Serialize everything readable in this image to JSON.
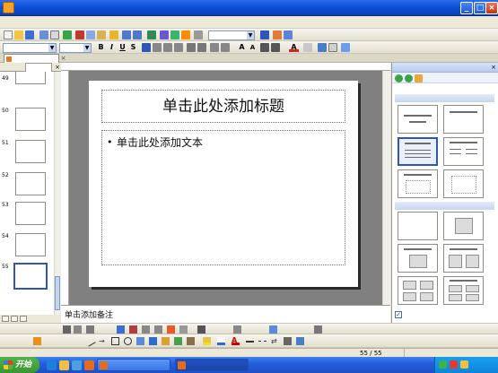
{
  "window": {
    "title": ""
  },
  "menu": {
    "items": [
      "",
      "",
      "",
      "",
      "",
      "",
      "",
      "",
      "",
      "",
      ""
    ]
  },
  "toolbar": {
    "zoom_value": "",
    "font_name": "",
    "font_size": ""
  },
  "doc_tabs": {
    "active_label": ""
  },
  "left_pane": {
    "tab_outline": "",
    "tab_slides": "",
    "slide_numbers": [
      "49",
      "50",
      "51",
      "52",
      "53",
      "54",
      "55"
    ]
  },
  "slide": {
    "title_placeholder": "单击此处添加标题",
    "body_bullet": "•",
    "body_placeholder": "单击此处添加文本"
  },
  "notes": {
    "placeholder": "单击添加备注"
  },
  "task_pane": {
    "title": "",
    "apply_label": "",
    "section_text_layouts": "",
    "section_content_layouts": "",
    "show_on_insert_label": ""
  },
  "drawing_toolbar": {
    "draw_label": "",
    "autoshapes_label": ""
  },
  "status_bar": {
    "slide_label": "",
    "slide_position": "55 / 55",
    "design_label": ""
  },
  "taskbar": {
    "start_label": "开始",
    "buttons": [
      "",
      ""
    ],
    "clock": ""
  },
  "colors": {
    "titlebar_blue": "#0a4fd8",
    "selection_blue": "#2f55b6",
    "start_green": "#3a9634"
  }
}
